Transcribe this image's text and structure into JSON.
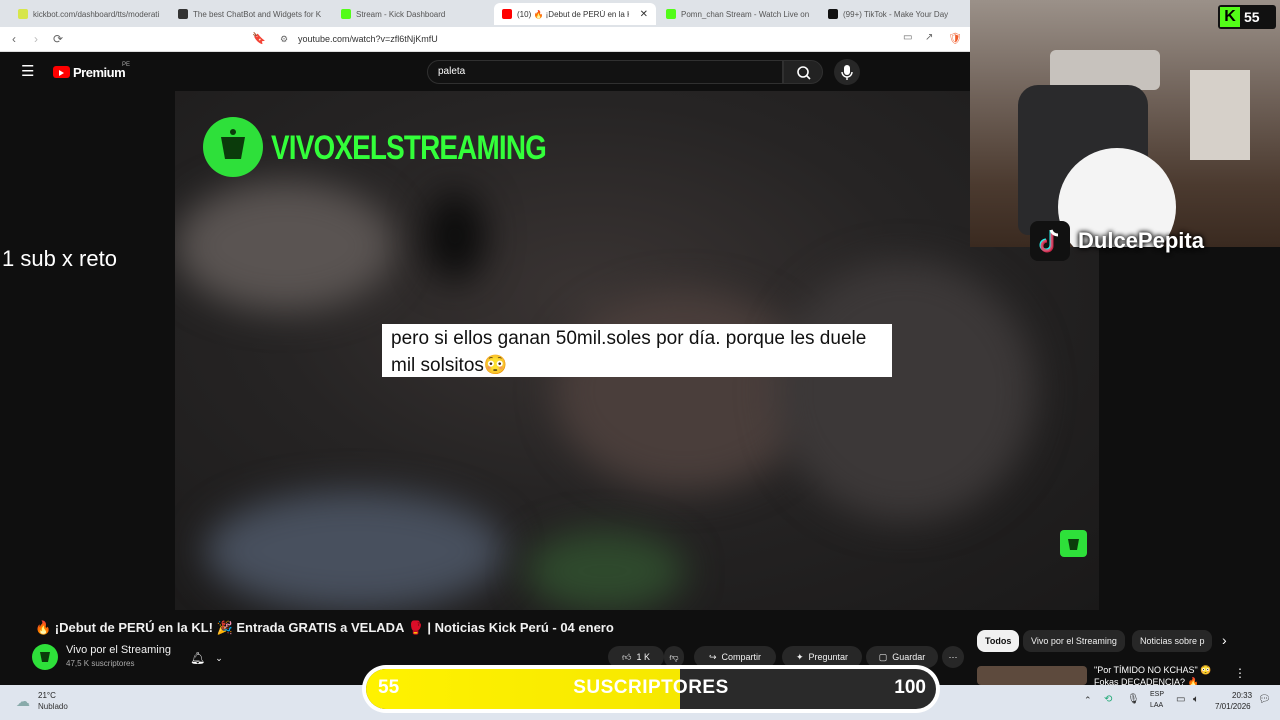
{
  "browser": {
    "tabs": [
      {
        "label": "kickbot.com/dashboard/tts/moderati",
        "color": "#d7e64a"
      },
      {
        "label": "The best ChatBot and Widgets for K",
        "color": "#333333"
      },
      {
        "label": "Stream - Kick Dashboard",
        "color": "#53fc18"
      },
      {
        "label": "(10) 🔥 ¡Debut de PERÚ en la K",
        "color": "#ff0000"
      },
      {
        "label": "Pomn_chan Stream - Watch Live on",
        "color": "#53fc18"
      },
      {
        "label": "(99+) TikTok - Make Your Day",
        "color": "#111111"
      }
    ],
    "active_tab": 3,
    "url": "youtube.com/watch?v=zfl6tNjKmfU"
  },
  "youtube": {
    "logo": "Premium",
    "region": "PE",
    "search_value": "paleta",
    "caption": "pero si ellos ganan 50mil.soles por día. porque les duele mil solsitos😳",
    "video_channel_watermark": "VIVOXELSTREAMING",
    "video_title": "🔥 ¡Debut de PERÚ en la KL! 🎉 Entrada GRATIS a VELADA 🥊 | Noticias Kick Perú - 04 enero",
    "channel_name": "Vivo por el Streaming",
    "subscribers": "47,5 K suscriptores",
    "actions": {
      "likes": "1 K",
      "share": "Compartir",
      "ask": "Preguntar",
      "save": "Guardar"
    },
    "chips": [
      "Todos",
      "Vivo por el Streaming",
      "Noticias sobre p"
    ],
    "rec_title": "\"Por TÍMIDO NO KCHAS\" 😳",
    "rec_title2": "Fokas DECADENCIA? 🔥"
  },
  "overlay": {
    "kick_viewers": "55",
    "tiktok_user": "DulcePepita",
    "sub_text": "1 sub x reto",
    "goal": {
      "current": "55",
      "label": "SUSCRIPTORES",
      "target": "100",
      "fraction": 0.55
    }
  },
  "taskbar": {
    "temperature": "21°C",
    "weather": "Nublado",
    "lang": "ESP",
    "lang_sub": "LAA",
    "time": "20:33",
    "date": "7/01/2026"
  }
}
